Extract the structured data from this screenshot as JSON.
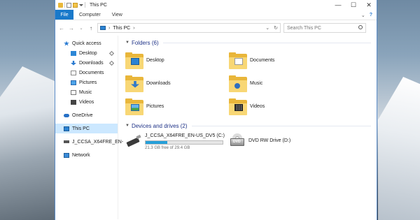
{
  "window": {
    "title": "This PC",
    "controls": {
      "minimize": "—",
      "maximize": "☐",
      "close": "✕"
    }
  },
  "menu": {
    "file": "File",
    "computer": "Computer",
    "view": "View"
  },
  "address": {
    "location": "This PC",
    "search_placeholder": "Search This PC"
  },
  "nav": {
    "quick_access": "Quick access",
    "items": [
      {
        "label": "Desktop",
        "pinned": true
      },
      {
        "label": "Downloads",
        "pinned": true
      },
      {
        "label": "Documents",
        "pinned": false
      },
      {
        "label": "Pictures",
        "pinned": false
      },
      {
        "label": "Music",
        "pinned": false
      },
      {
        "label": "Videos",
        "pinned": false
      }
    ],
    "onedrive": "OneDrive",
    "this_pc": "This PC",
    "usb": "J_CCSA_X64FRE_EN-",
    "network": "Network"
  },
  "folders": {
    "header": "Folders (6)",
    "items": [
      {
        "label": "Desktop",
        "icon": "desktop-folder-icon"
      },
      {
        "label": "Documents",
        "icon": "documents-folder-icon"
      },
      {
        "label": "Downloads",
        "icon": "downloads-folder-icon"
      },
      {
        "label": "Music",
        "icon": "music-folder-icon"
      },
      {
        "label": "Pictures",
        "icon": "pictures-folder-icon"
      },
      {
        "label": "Videos",
        "icon": "videos-folder-icon"
      }
    ]
  },
  "devices": {
    "header": "Devices and drives (2)",
    "usb_name": "J_CCSA_X64FRE_EN-US_DV5 (C:)",
    "usb_free": "21.3 GB free of 29.4 GB",
    "usb_used_fraction": 0.28,
    "dvd_name": "DVD RW Drive (D:)",
    "dvd_badge": "DVD"
  },
  "colors": {
    "accent": "#1979ca",
    "selection": "#cce8ff",
    "header_text": "#1e3287",
    "bar_fill": "#26a0da"
  }
}
